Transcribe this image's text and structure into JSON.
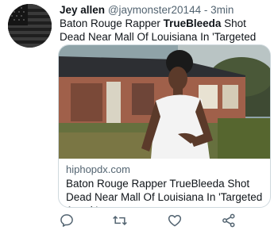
{
  "tweet": {
    "author_name": "Jey allen",
    "handle": "@jaymonster20144",
    "separator": " - ",
    "time": "3min",
    "text_part1": "Baton Rouge Rapper ",
    "text_bold": "TrueBleeda",
    "text_part2": " Shot Dead Near Mall Of Louisiana In 'Targeted Attack'"
  },
  "card": {
    "domain": "hiphopdx.com",
    "title": "Baton Rouge Rapper TrueBleeda Shot Dead Near Mall Of Louisiana In 'Targeted Attack'"
  },
  "actions": {
    "icons": [
      "reply-icon",
      "retweet-icon",
      "like-icon",
      "share-icon"
    ]
  },
  "colors": {
    "text": "#0f1419",
    "secondary": "#536471",
    "border": "#cfd9de"
  }
}
